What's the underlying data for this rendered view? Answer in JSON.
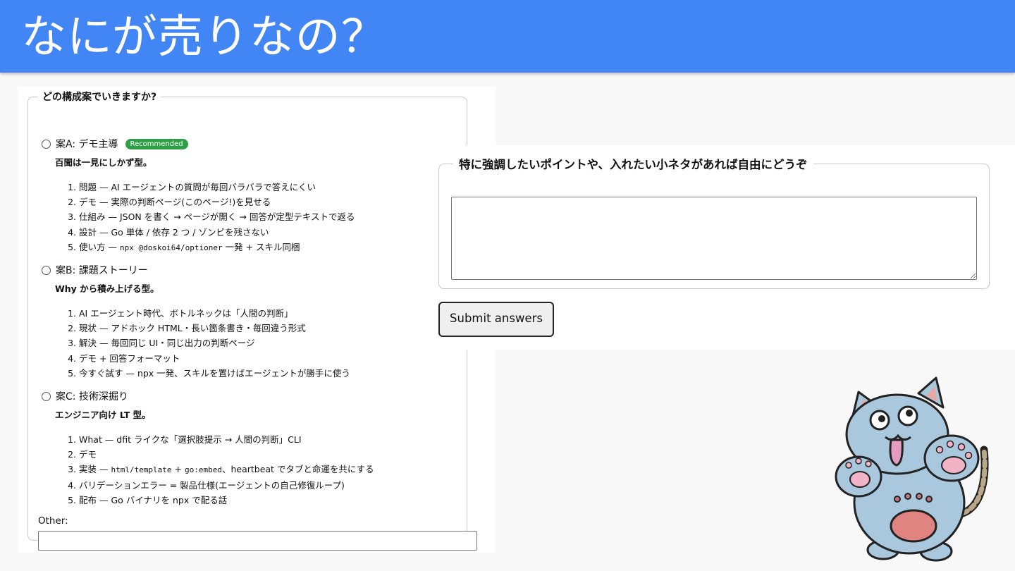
{
  "slide": {
    "title": "なにが売りなの？"
  },
  "question1": {
    "legend": "どの構成案でいきますか?",
    "options": [
      {
        "label": "案A: デモ主導",
        "badge": "Recommended",
        "subtitle": "百聞は一見にしかず型。",
        "items": [
          [
            "問題 — AI エージェントの質問が毎回バラバラで答えにくい"
          ],
          [
            "デモ — 実際の判断ページ(このページ!)を見せる"
          ],
          [
            "仕組み — JSON を書く → ページが開く → 回答が定型テキストで返る"
          ],
          [
            "設計 — Go 単体 / 依存 2 つ / ゾンビを残さない"
          ],
          [
            "使い方 — ",
            "npx @doskoi64/optioner",
            " 一発 + スキル同梱"
          ]
        ]
      },
      {
        "label": "案B: 課題ストーリー",
        "subtitle": "Why から積み上げる型。",
        "items": [
          [
            "AI エージェント時代、ボトルネックは「人間の判断」"
          ],
          [
            "現状 — アドホック HTML・長い箇条書き・毎回違う形式"
          ],
          [
            "解決 — 毎回同じ UI・同じ出力の判断ページ"
          ],
          [
            "デモ + 回答フォーマット"
          ],
          [
            "今すぐ試す — npx 一発、スキルを置けばエージェントが勝手に使う"
          ]
        ]
      },
      {
        "label": "案C: 技術深掘り",
        "subtitle": "エンジニア向け LT 型。",
        "items": [
          [
            "What — dfit ライクな「選択肢提示 → 人間の判断」CLI"
          ],
          [
            "デモ"
          ],
          [
            "実装 — ",
            "html/template",
            " + ",
            "go:embed",
            "、heartbeat でタブと命運を共にする"
          ],
          [
            "バリデーションエラー = 製品仕様(エージェントの自己修復ループ)"
          ],
          [
            "配布 — Go バイナリを npx で配る話"
          ]
        ]
      }
    ],
    "other_label": "Other:",
    "other_value": ""
  },
  "question2": {
    "legend": "特に強調したいポイントや、入れたい小ネタがあれば自由にどうぞ",
    "value": ""
  },
  "submit_label": "Submit answers",
  "colors": {
    "banner": "#4285f4",
    "badge": "#2e9e46",
    "mascot_body": "#a9c7dd"
  },
  "icons": {
    "mascot": "cartoon-cat-illustration"
  }
}
